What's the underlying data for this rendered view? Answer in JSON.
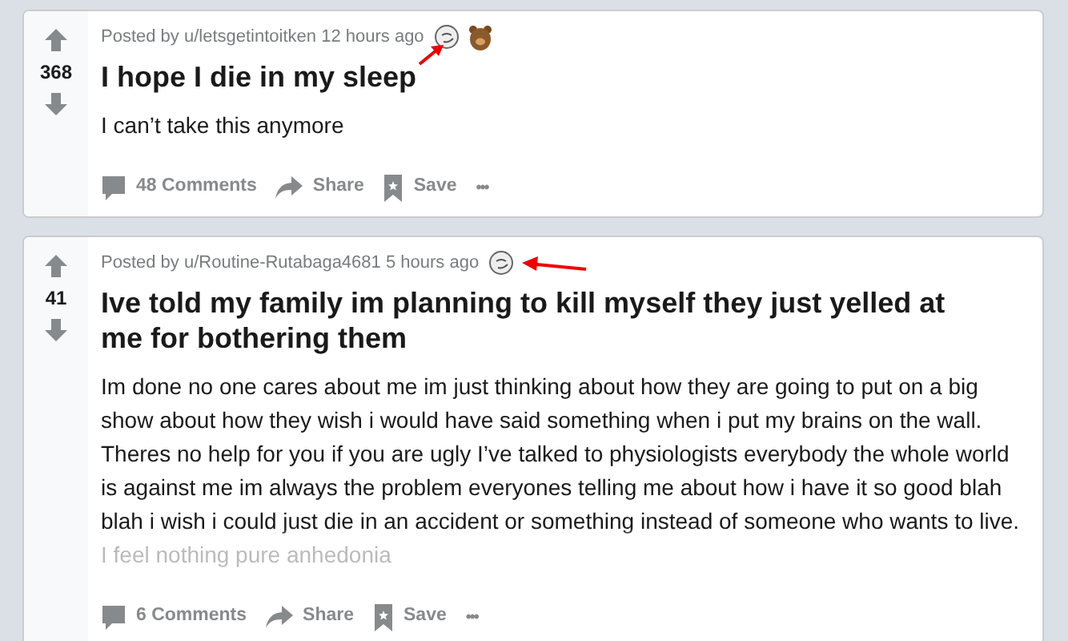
{
  "posts": [
    {
      "votes": "368",
      "meta": "Posted by u/letsgetintoitken 12 hours ago",
      "awards": [
        {
          "kind": "face"
        },
        {
          "kind": "bear"
        }
      ],
      "annotated": true,
      "title": "I hope I die in my sleep",
      "body": "I can’t take this anymore",
      "faded": false,
      "actions": {
        "comments": "48 Comments",
        "share": "Share",
        "save": "Save",
        "more": "•••"
      }
    },
    {
      "votes": "41",
      "meta": "Posted by u/Routine-Rutabaga4681 5 hours ago",
      "awards": [
        {
          "kind": "face"
        }
      ],
      "annotated": true,
      "title": "Ive told my family im planning to kill myself they just yelled at me for bothering them",
      "body": "Im done no one cares about me im just thinking about how they are going to put on a big show about how they wish i would have said something when i put my brains on the wall. Theres no help for you if you are ugly I’ve talked to physiologists everybody the whole world is against me im always the problem everyones telling me about how i have it so good blah blah i wish i could just die in an accident or something instead of someone who wants to live. I feel nothing pure anhedonia",
      "faded": true,
      "actions": {
        "comments": "6 Comments",
        "share": "Share",
        "save": "Save",
        "more": "•••"
      }
    }
  ]
}
